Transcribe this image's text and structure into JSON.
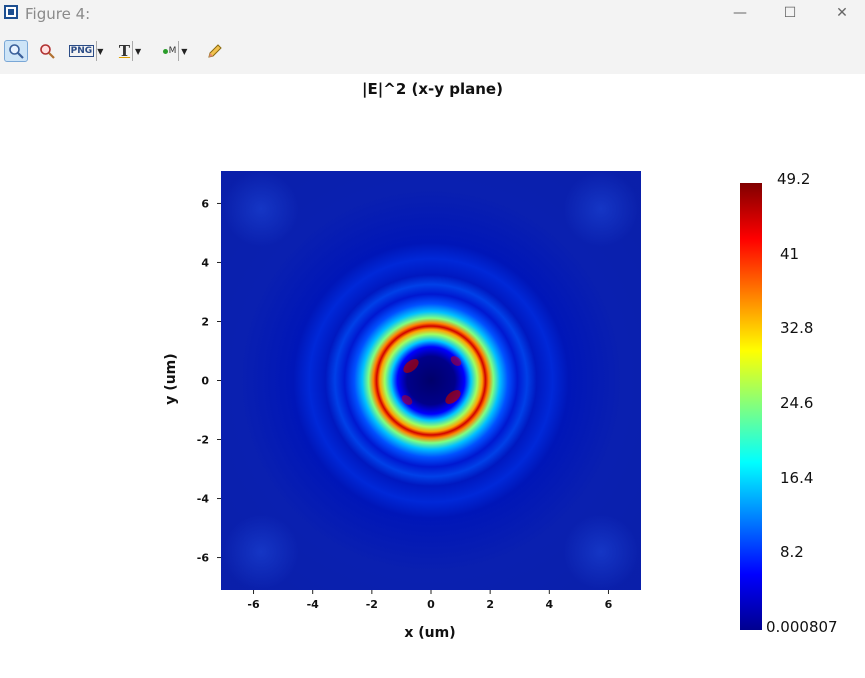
{
  "window": {
    "title": "Figure 4:",
    "minimize_glyph": "—",
    "maximize_glyph": "☐",
    "close_glyph": "✕"
  },
  "toolbar": {
    "buttons": [
      {
        "name": "zoom-tool",
        "icon": "magnifier-icon",
        "active": true
      },
      {
        "name": "zoom-reset",
        "icon": "zoom-red-magnifier-icon"
      },
      {
        "name": "export-png",
        "label": "PNG",
        "icon": "png-export-icon",
        "dropdown": true
      },
      {
        "name": "text-tool",
        "label": "T",
        "icon": "text-insert-icon",
        "dropdown": true
      },
      {
        "name": "marker-tool",
        "label": "M",
        "icon": "marker-icon",
        "dropdown": true
      },
      {
        "name": "pencil-tool",
        "icon": "pencil-icon"
      }
    ]
  },
  "chart_data": {
    "type": "heatmap",
    "title": "|E|^2 (x-y plane)",
    "xlabel": "x (um)",
    "ylabel": "y (um)",
    "xlim": [
      -7.1,
      7.1
    ],
    "ylim": [
      -7.1,
      7.1
    ],
    "xticks": [
      -6,
      -4,
      -2,
      0,
      2,
      4,
      6
    ],
    "yticks": [
      6,
      4,
      2,
      0,
      -2,
      -4,
      -6
    ],
    "colormap": "jet",
    "colorbar": {
      "min": 0.000807,
      "max": 49.2,
      "ticks": [
        "49.2",
        "41",
        "32.8",
        "24.6",
        "16.4",
        "8.2",
        "0.000807"
      ]
    },
    "features": [
      {
        "kind": "ring",
        "center": [
          0,
          0
        ],
        "radius_um": 0.8,
        "peak": 49.2
      },
      {
        "kind": "ring",
        "center": [
          0,
          0
        ],
        "radius_um": 1.6,
        "peak": 8
      },
      {
        "kind": "ring",
        "center": [
          0,
          0
        ],
        "radius_um": 2.4,
        "peak": 4
      }
    ],
    "background_value": 2
  },
  "colors": {
    "background_blue": "#0a20a8",
    "ring_peak": "#c80000"
  }
}
